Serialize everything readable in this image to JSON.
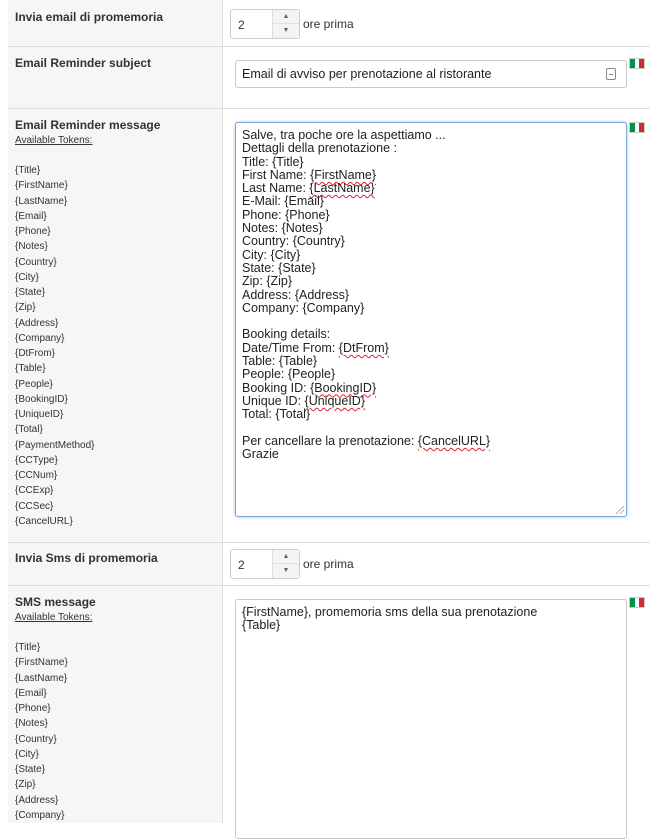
{
  "available_tokens_label": "Available Tokens:",
  "reminder_email": {
    "label": "Invia email di promemoria",
    "value": "2",
    "unit": "ore prima"
  },
  "email_subject": {
    "label": "Email Reminder subject",
    "value": "Email di avviso per prenotazione al ristorante"
  },
  "email_message": {
    "label": "Email Reminder message",
    "tokens": [
      "{Title}",
      "{FirstName}",
      "{LastName}",
      "{Email}",
      "{Phone}",
      "{Notes}",
      "{Country}",
      "{City}",
      "{State}",
      "{Zip}",
      "{Address}",
      "{Company}",
      "{DtFrom}",
      "{Table}",
      "{People}",
      "{BookingID}",
      "{UniqueID}",
      "{Total}",
      "{PaymentMethod}",
      "{CCType}",
      "{CCNum}",
      "{CCExp}",
      "{CCSec}",
      "{CancelURL}"
    ],
    "lines": [
      "Salve, tra poche ore la aspettiamo ...",
      "Dettagli della prenotazione :",
      "Title: {Title}",
      "First Name: {FirstName}",
      "Last Name: {LastName}",
      "E-Mail: {Email}",
      "Phone: {Phone}",
      "Notes: {Notes}",
      "Country: {Country}",
      "City: {City}",
      "State: {State}",
      "Zip: {Zip}",
      "Address: {Address}",
      "Company: {Company}",
      "",
      "Booking details:",
      "Date/Time From: {DtFrom}",
      "Table: {Table}",
      "People: {People}",
      "Booking ID: {BookingID}",
      "Unique ID: {UniqueID}",
      "Total: {Total}",
      "",
      "Per cancellare la prenotazione: {CancelURL}",
      "Grazie"
    ]
  },
  "reminder_sms": {
    "label": "Invia Sms di promemoria",
    "value": "2",
    "unit": "ore prima"
  },
  "sms_message": {
    "label": "SMS message",
    "tokens": [
      "{Title}",
      "{FirstName}",
      "{LastName}",
      "{Email}",
      "{Phone}",
      "{Notes}",
      "{Country}",
      "{City}",
      "{State}",
      "{Zip}",
      "{Address}",
      "{Company}"
    ],
    "lines": [
      "{FirstName}, promemoria sms della sua prenotazione",
      "{Table}"
    ]
  },
  "colors": {
    "label_bg": "#f6f6f6",
    "border": "#dddddd",
    "focus": "#7aa7d8"
  },
  "icons": {
    "language_flag": "italian-flag-icon",
    "spinner": "spinner-arrows-icon"
  }
}
